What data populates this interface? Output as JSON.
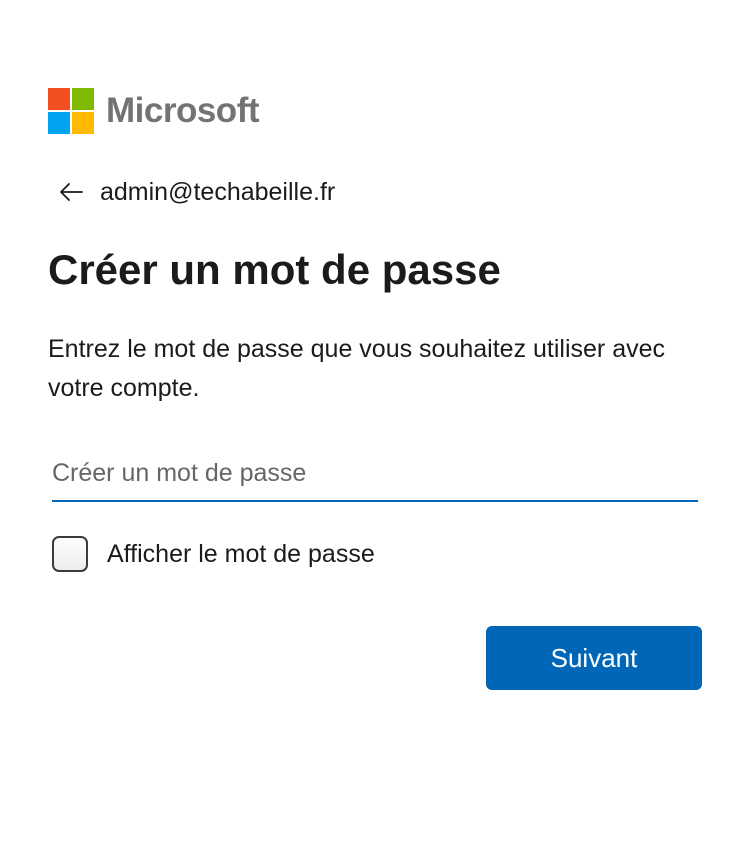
{
  "brand": {
    "name": "Microsoft",
    "colors": {
      "red": "#f25022",
      "green": "#7fba00",
      "blue": "#00a4ef",
      "yellow": "#ffb900"
    }
  },
  "identity": {
    "back_icon": "arrow-left-icon",
    "email": "admin@techabeille.fr"
  },
  "title": "Créer un mot de passe",
  "description": "Entrez le mot de passe que vous souhaitez utiliser avec votre compte.",
  "password_field": {
    "value": "",
    "placeholder": "Créer un mot de passe"
  },
  "show_password": {
    "label": "Afficher le mot de passe",
    "checked": false
  },
  "next_button": {
    "label": "Suivant"
  },
  "theme": {
    "accent": "#0067b8"
  }
}
